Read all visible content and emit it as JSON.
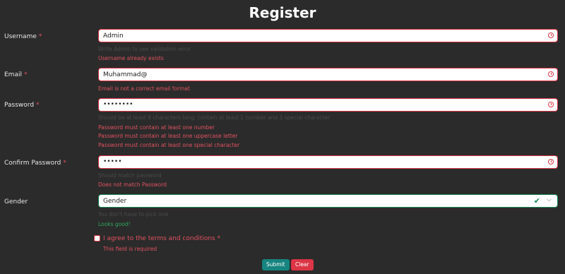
{
  "form": {
    "title": "Register",
    "required_mark": "*",
    "username": {
      "label": "Username",
      "value": "Admin",
      "help": "Write Admin to see validation error",
      "errors": [
        "Username already exists"
      ]
    },
    "email": {
      "label": "Email",
      "value": "Muhammad@",
      "errors": [
        "Email is not a correct email format"
      ]
    },
    "password": {
      "label": "Password",
      "value": "••••••••",
      "help": "Should be at least 8 characters long, contain at least 1 number and 1 special character",
      "errors": [
        "Password must contain at least one number",
        "Password must contain at least one uppercase letter",
        "Password must contain at least one special character"
      ]
    },
    "confirm_password": {
      "label": "Confirm Password",
      "value": "•••••",
      "help": "Should match password",
      "errors": [
        "Does not match Password"
      ]
    },
    "gender": {
      "label": "Gender",
      "value": "Gender",
      "help": "You don't have to pick one",
      "valid_feedback": "Looks good!"
    },
    "terms": {
      "label": "I agree to the terms and conditions",
      "error": "This field is required"
    },
    "buttons": {
      "submit": "Submit",
      "clear": "Clear"
    }
  },
  "colors": {
    "background": "#2b2b2b",
    "error": "#dc3545",
    "success": "#198754",
    "submit": "#16847f"
  }
}
